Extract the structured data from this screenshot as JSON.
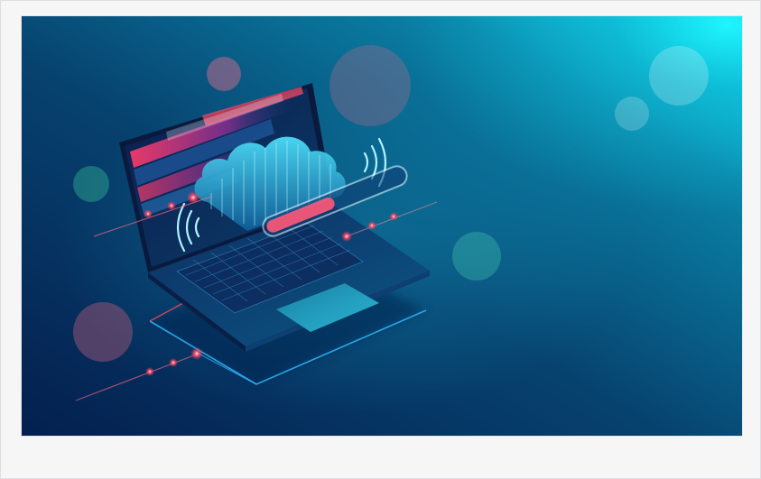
{
  "image": {
    "subject": "cloud-computing-laptop",
    "palette": {
      "deep_navy": "#05285a",
      "teal": "#0a6c8c",
      "cyan_glow": "#12f5ff",
      "red_accent": "#ff3b5c",
      "bokeh_pink": "#b05a7a",
      "bokeh_green": "#3fd0a0"
    }
  }
}
